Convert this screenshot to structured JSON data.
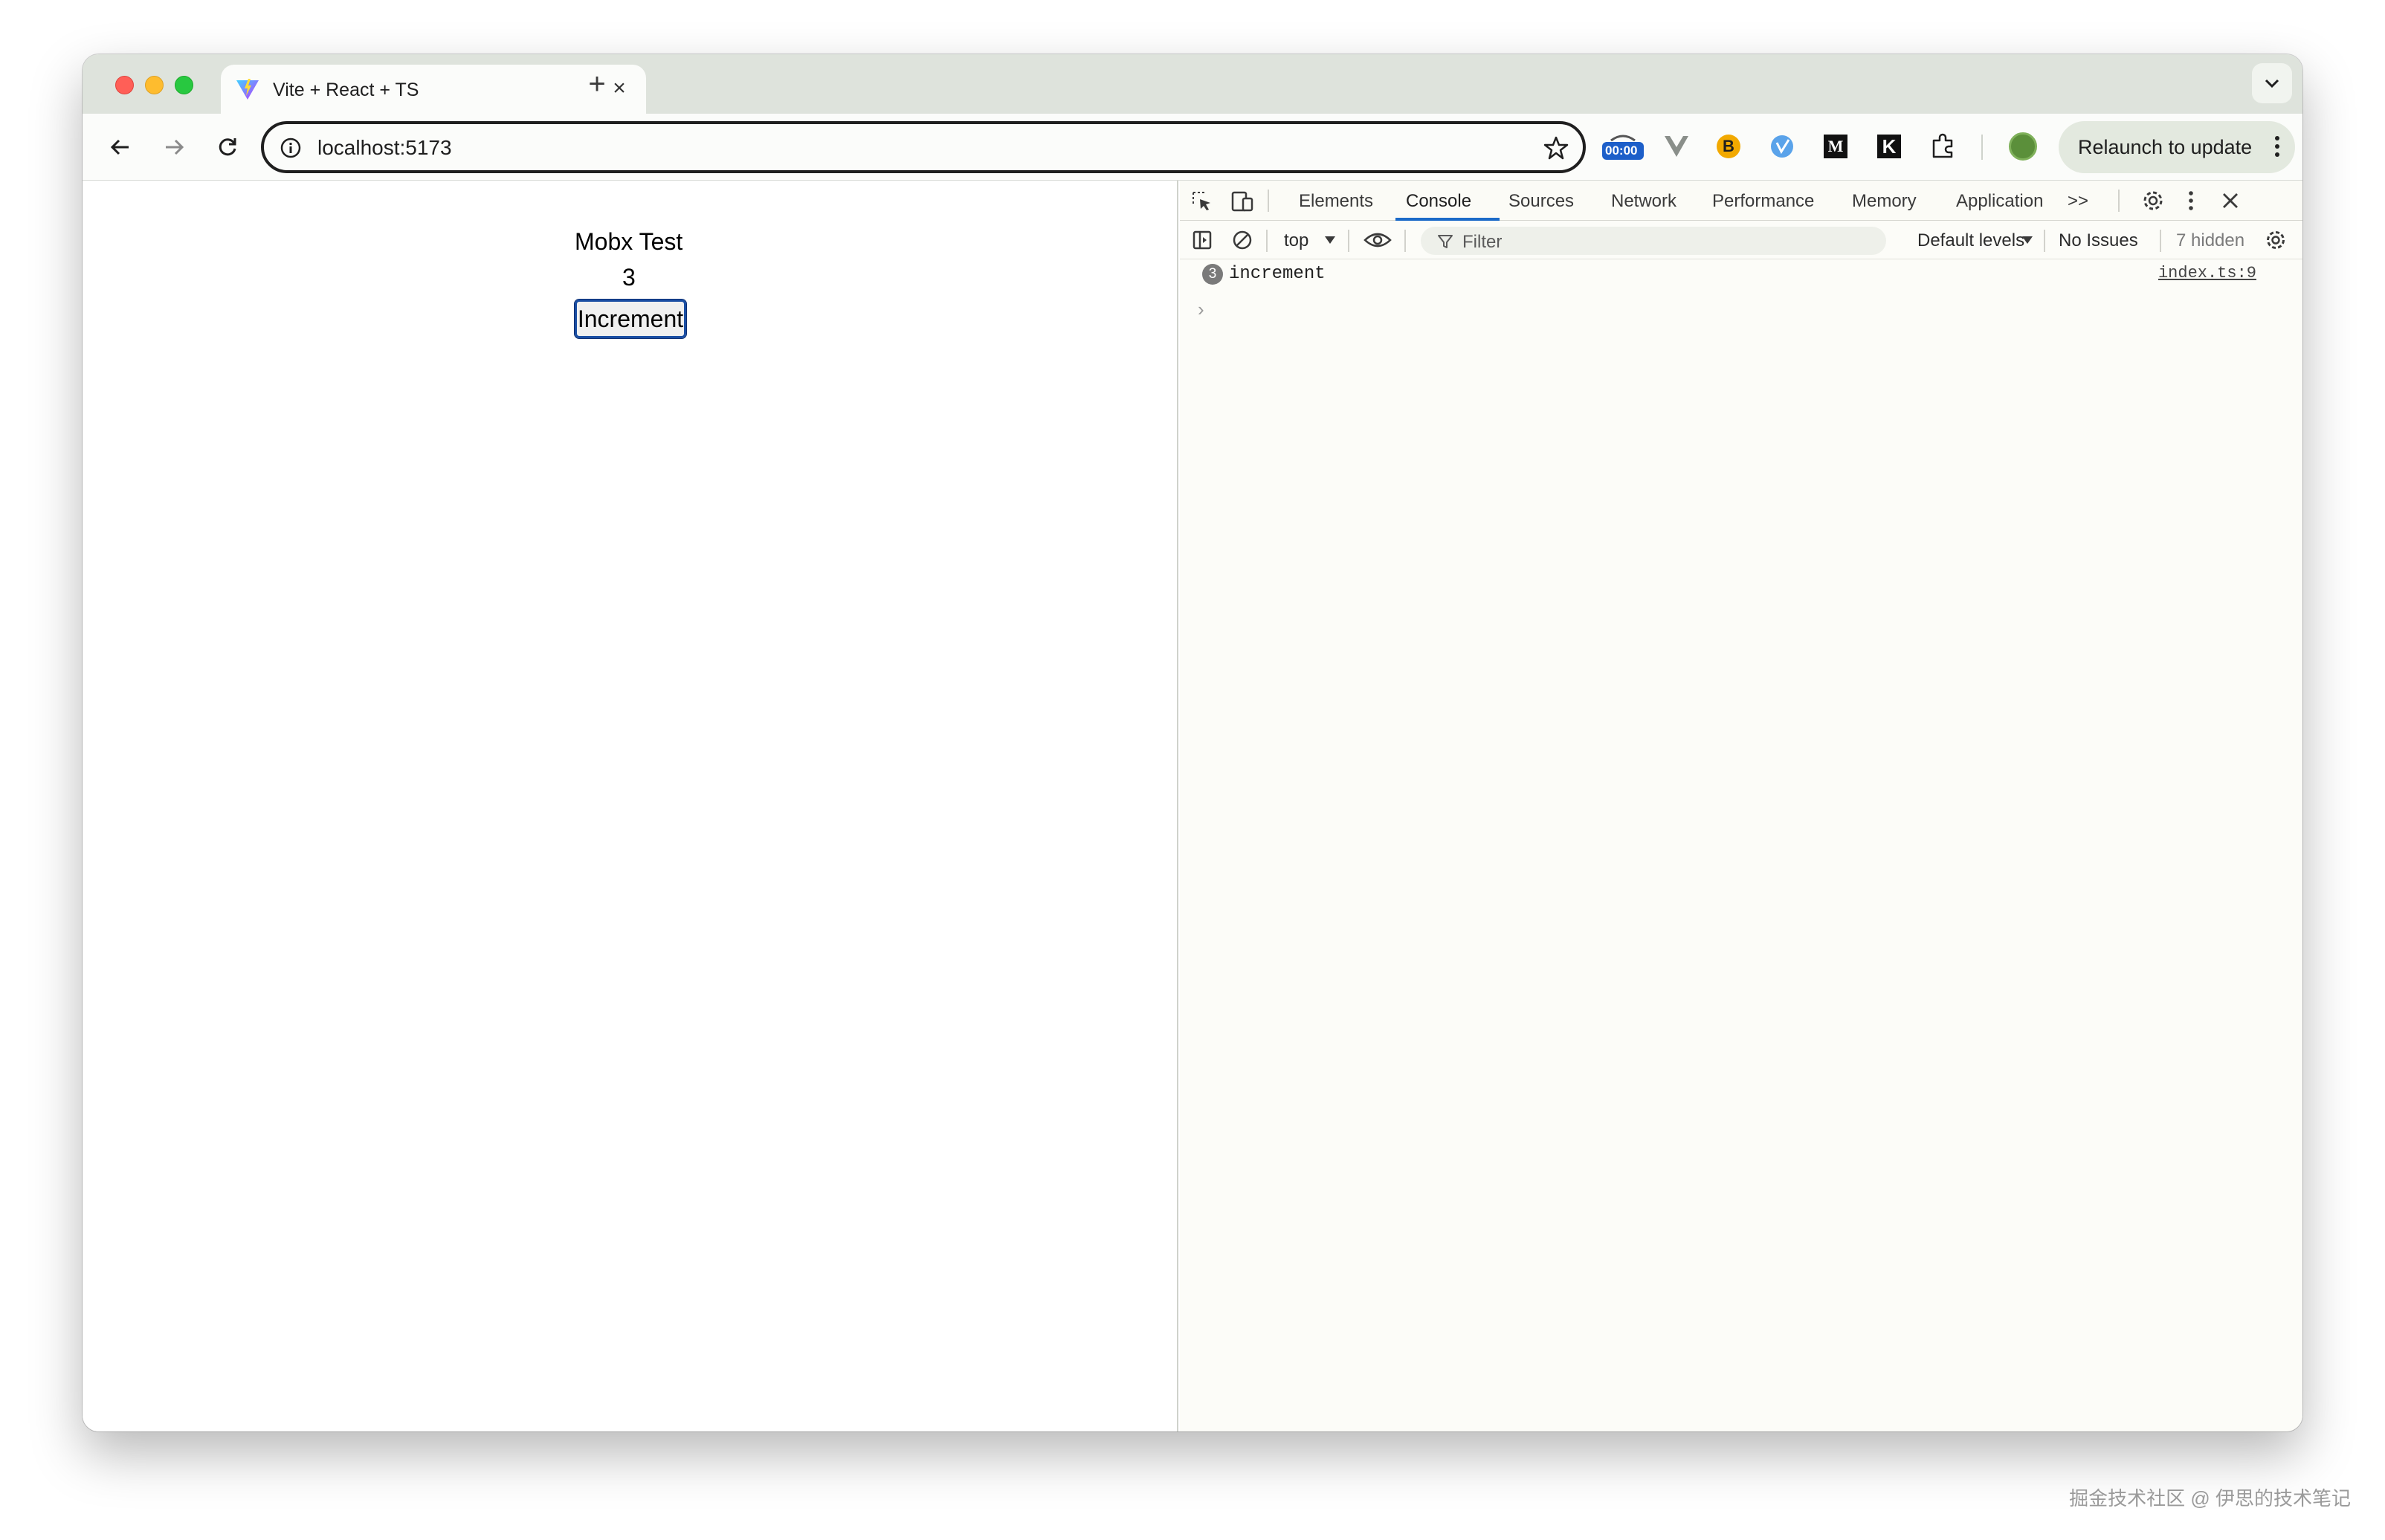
{
  "browser": {
    "tab_title": "Vite + React + TS",
    "tab_close": "×",
    "new_tab": "+",
    "url": "localhost:5173",
    "relaunch_label": "Relaunch to update",
    "extensions": [
      "timer-extension-icon",
      "vue-devtools-icon",
      "b-extension-icon",
      "translate-extension-icon",
      "m-extension-icon",
      "k-extension-icon",
      "puzzle-icon",
      "profile-avatar"
    ],
    "ext_timer_text": "00:00",
    "ext_b_text": "B",
    "ext_m_text": "M",
    "ext_k_text": "K",
    "accent": "#1a4ea3"
  },
  "app": {
    "title": "Mobx Test",
    "count": "3",
    "button_label": "Increment"
  },
  "devtools": {
    "tabs": [
      "Elements",
      "Console",
      "Sources",
      "Network",
      "Performance",
      "Memory",
      "Application"
    ],
    "active_tab": "Console",
    "more_tabs": ">>",
    "context": "top",
    "filter_placeholder": "Filter",
    "levels": "Default levels",
    "issues": "No Issues",
    "hidden": "7 hidden",
    "messages": [
      {
        "count": "3",
        "text": "increment",
        "source": "index.ts:9"
      }
    ],
    "prompt_symbol": "›"
  },
  "watermark": "掘金技术社区 @ 伊思的技术笔记"
}
